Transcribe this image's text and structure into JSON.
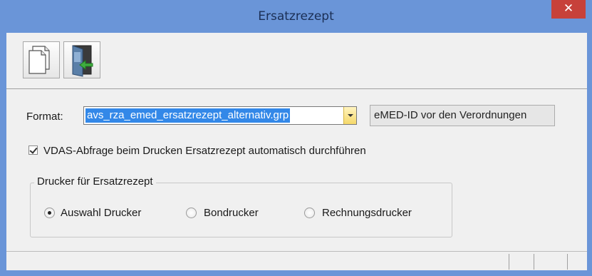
{
  "window": {
    "title": "Ersatzrezept",
    "close_label": "✕"
  },
  "toolbar": {
    "buttons": [
      {
        "name": "new-document",
        "icon": "document-icon"
      },
      {
        "name": "exit",
        "icon": "exit-door-icon"
      }
    ]
  },
  "format": {
    "label": "Format:",
    "value": "avs_rza_emed_ersatzrezept_alternativ.grp"
  },
  "emed_button": {
    "label": "eMED-ID vor den Verordnungen"
  },
  "vdas_checkbox": {
    "label": "VDAS-Abfrage beim Drucken Ersatzrezept automatisch durchführen",
    "checked": true
  },
  "printer_group": {
    "legend": "Drucker für Ersatzrezept",
    "options": [
      {
        "label": "Auswahl Drucker",
        "checked": true
      },
      {
        "label": "Bondrucker",
        "checked": false
      },
      {
        "label": "Rechnungsdrucker",
        "checked": false
      }
    ]
  },
  "colors": {
    "titlebar": "#6a95d8",
    "close": "#c7413a",
    "selection": "#3388e8",
    "panel": "#f0f0f0"
  }
}
